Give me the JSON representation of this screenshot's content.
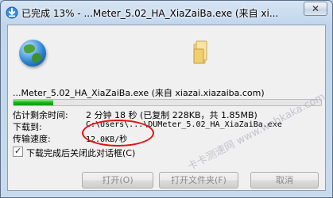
{
  "window": {
    "title": "已完成 13% - ...Meter_5.02_HA_XiaZaiBa.exe (来自 xi...",
    "close_glyph": "✕"
  },
  "download": {
    "filename_line": "...Meter_5.02_HA_XiaZaiBa.exe (来自 xiazai.xiazaiba.com)",
    "progress_fraction": 0.13,
    "eta_label": "估计剩余时间:",
    "eta_value": "2 分钟 18 秒 (已复制 228KB，共 1.85MB)",
    "download_to_label": "下载到:",
    "download_to_value": "C:\\Users\\...\\DUMeter_5.02_HA_XiaZaiBa.exe",
    "transfer_rate_label": "传输速度:",
    "transfer_rate_value": "12.0KB/秒",
    "close_on_complete_label": "下载完成后关闭此对话框(C)",
    "close_on_complete_checked": true
  },
  "buttons": {
    "open": "打开(O)",
    "open_folder": "打开文件夹(F)",
    "close": "取消"
  },
  "icons": {
    "app": "download-ie-icon",
    "globe": "globe-icon",
    "folder": "folder-icon",
    "close": "close-icon"
  },
  "watermark": {
    "text": "卡卡测速网 www.webkaka.com"
  },
  "colors": {
    "progress_fill": "#14b314",
    "annotation_circle": "#e01010"
  }
}
